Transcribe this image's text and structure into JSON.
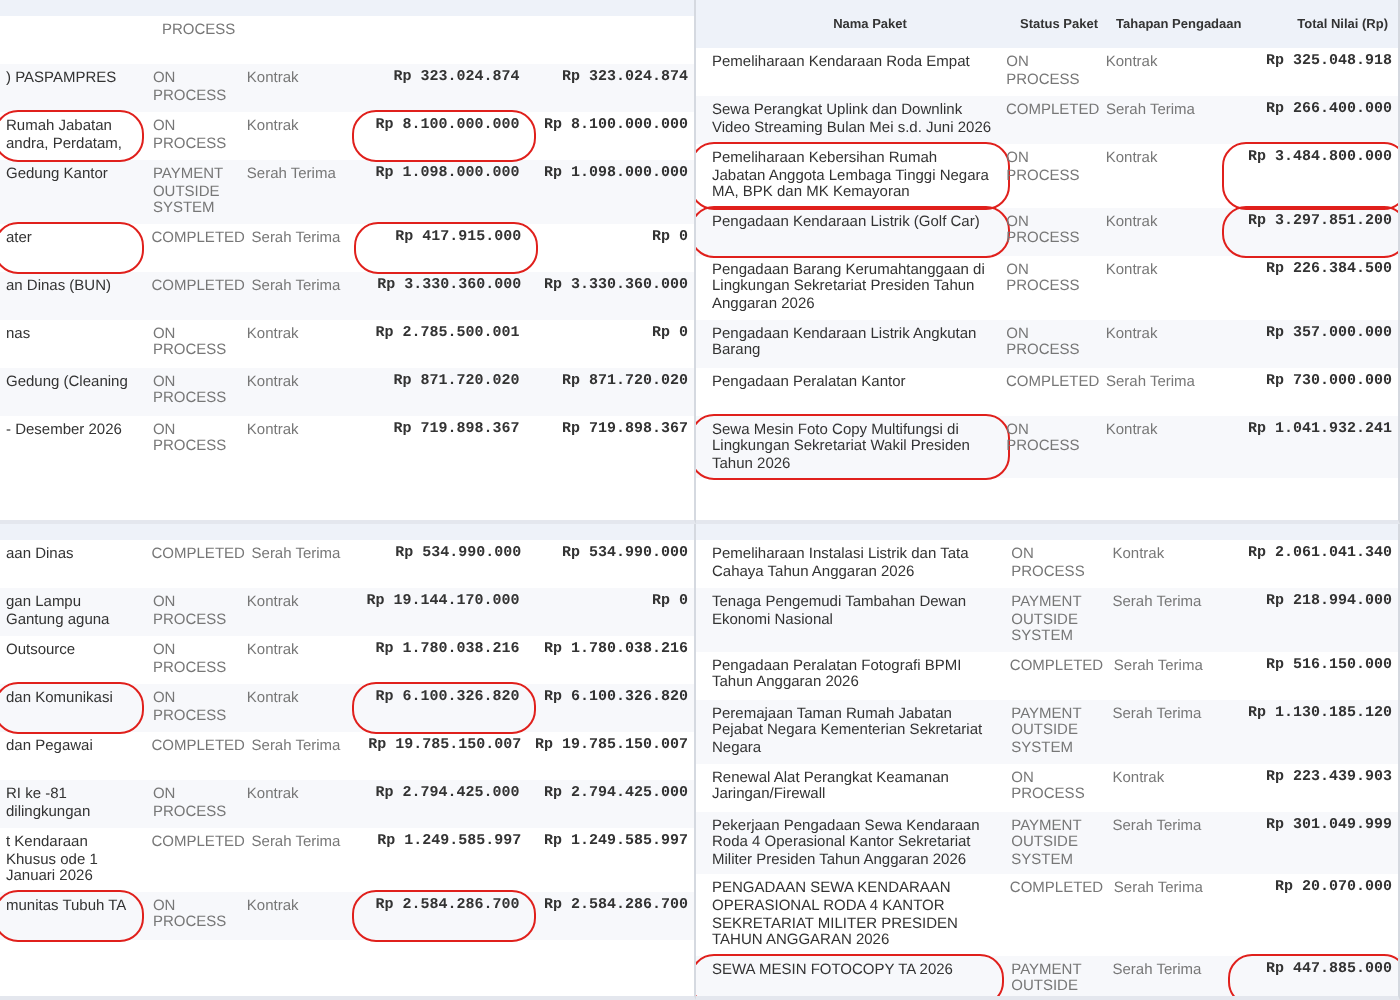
{
  "panels": [
    {
      "rows": [
        {
          "status": "PROCESS"
        },
        {
          "name": ") PASPAMPRES",
          "status": "ON PROCESS",
          "stage": "Kontrak",
          "value": "Rp 323.024.874",
          "value_2": "Rp 323.024.874",
          "circled_name": false,
          "circled_value": false
        },
        {
          "name": "Rumah Jabatan andra, Perdatam,",
          "status": "ON PROCESS",
          "stage": "Kontrak",
          "value": "Rp 8.100.000.000",
          "value_2": "Rp 8.100.000.000",
          "circled_name": true,
          "circled_value": true
        },
        {
          "name": "Gedung Kantor",
          "status": "PAYMENT OUTSIDE SYSTEM",
          "stage": "Serah Terima",
          "value": "Rp 1.098.000.000",
          "value_2": "Rp 1.098.000.000",
          "circled_name": false,
          "circled_value": false
        },
        {
          "name": "ater",
          "status": "COMPLETED",
          "stage": "Serah Terima",
          "value": "Rp 417.915.000",
          "value_2": "Rp 0",
          "circled_name": true,
          "circled_value": true
        },
        {
          "name": "an Dinas (BUN)",
          "status": "COMPLETED",
          "stage": "Serah Terima",
          "value": "Rp 3.330.360.000",
          "value_2": "Rp 3.330.360.000",
          "circled_name": false,
          "circled_value": false
        },
        {
          "name": "nas",
          "status": "ON PROCESS",
          "stage": "Kontrak",
          "value": "Rp 2.785.500.001",
          "value_2": "Rp 0",
          "circled_name": false,
          "circled_value": false
        },
        {
          "name": "Gedung (Cleaning",
          "status": "ON PROCESS",
          "stage": "Kontrak",
          "value": "Rp 871.720.020",
          "value_2": "Rp 871.720.020",
          "circled_name": false,
          "circled_value": false
        },
        {
          "name": "- Desember 2026",
          "status": "ON PROCESS",
          "stage": "Kontrak",
          "value": "Rp 719.898.367",
          "value_2": "Rp 719.898.367",
          "circled_name": false,
          "circled_value": false
        }
      ]
    },
    {
      "rows": [
        {
          "name": "aan Dinas",
          "status": "COMPLETED",
          "stage": "Serah Terima",
          "value": "Rp 534.990.000",
          "value_2": "Rp 534.990.000",
          "circled_name": false,
          "circled_value": false
        },
        {
          "name": "gan Lampu Gantung aguna",
          "status": "ON PROCESS",
          "stage": "Kontrak",
          "value": "Rp 19.144.170.000",
          "value_2": "Rp 0",
          "circled_name": false,
          "circled_value": false
        },
        {
          "name": "Outsource",
          "status": "ON PROCESS",
          "stage": "Kontrak",
          "value": "Rp 1.780.038.216",
          "value_2": "Rp 1.780.038.216",
          "circled_name": false,
          "circled_value": false
        },
        {
          "name": "dan Komunikasi",
          "status": "ON PROCESS",
          "stage": "Kontrak",
          "value": "Rp 6.100.326.820",
          "value_2": "Rp 6.100.326.820",
          "circled_name": true,
          "circled_value": true
        },
        {
          "name": "dan Pegawai",
          "status": "COMPLETED",
          "stage": "Serah Terima",
          "value": "Rp 19.785.150.007",
          "value_2": "Rp 19.785.150.007",
          "circled_name": false,
          "circled_value": false
        },
        {
          "name": "RI ke -81 dilingkungan",
          "status": "ON PROCESS",
          "stage": "Kontrak",
          "value": "Rp 2.794.425.000",
          "value_2": "Rp 2.794.425.000",
          "circled_name": false,
          "circled_value": false
        },
        {
          "name": "t Kendaraan Khusus ode 1 Januari 2026",
          "status": "COMPLETED",
          "stage": "Serah Terima",
          "value": "Rp 1.249.585.997",
          "value_2": "Rp 1.249.585.997",
          "circled_name": false,
          "circled_value": false
        },
        {
          "name": "munitas Tubuh TA",
          "status": "ON PROCESS",
          "stage": "Kontrak",
          "value": "Rp 2.584.286.700",
          "value_2": "Rp 2.584.286.700",
          "circled_name": true,
          "circled_value": true
        }
      ]
    },
    {
      "columns": [
        "Nama Paket",
        "Status Paket",
        "Tahapan Pengadaan",
        "Total Nilai (Rp)"
      ],
      "rows": [
        {
          "name": "Pemeliharaan Kendaraan Roda Empat",
          "status": "ON PROCESS",
          "stage": "Kontrak",
          "value": "Rp 325.048.918",
          "circled_name": false,
          "circled_value": false
        },
        {
          "name": "Sewa Perangkat Uplink dan Downlink Video Streaming Bulan Mei s.d. Juni 2026",
          "status": "COMPLETED",
          "stage": "Serah Terima",
          "value": "Rp 266.400.000",
          "circled_name": false,
          "circled_value": false
        },
        {
          "name": "Pemeliharaan Kebersihan Rumah Jabatan Anggota Lembaga Tinggi Negara MA, BPK dan MK Kemayoran",
          "status": "ON PROCESS",
          "stage": "Kontrak",
          "value": "Rp 3.484.800.000",
          "circled_name": true,
          "circled_value": true
        },
        {
          "name": "Pengadaan Kendaraan Listrik (Golf Car)",
          "status": "ON PROCESS",
          "stage": "Kontrak",
          "value": "Rp 3.297.851.200",
          "circled_name": true,
          "circled_value": true
        },
        {
          "name": "Pengadaan Barang Kerumahtanggaan di Lingkungan Sekretariat Presiden Tahun Anggaran 2026",
          "status": "ON PROCESS",
          "stage": "Kontrak",
          "value": "Rp 226.384.500",
          "circled_name": false,
          "circled_value": false
        },
        {
          "name": "Pengadaan Kendaraan Listrik Angkutan Barang",
          "status": "ON PROCESS",
          "stage": "Kontrak",
          "value": "Rp 357.000.000",
          "circled_name": false,
          "circled_value": false
        },
        {
          "name": "Pengadaan Peralatan Kantor",
          "status": "COMPLETED",
          "stage": "Serah Terima",
          "value": "Rp 730.000.000",
          "circled_name": false,
          "circled_value": false
        },
        {
          "name": "Sewa Mesin Foto Copy Multifungsi di Lingkungan Sekretariat Wakil Presiden Tahun 2026",
          "status": "ON PROCESS",
          "stage": "Kontrak",
          "value": "Rp 1.041.932.241",
          "circled_name": true,
          "circled_value": false
        }
      ]
    },
    {
      "rows": [
        {
          "name": "Pemeliharaan Instalasi Listrik dan Tata Cahaya Tahun Anggaran 2026",
          "status": "ON PROCESS",
          "stage": "Kontrak",
          "value": "Rp 2.061.041.340",
          "circled_name": false,
          "circled_value": false
        },
        {
          "name": "Tenaga Pengemudi Tambahan Dewan Ekonomi Nasional",
          "status": "PAYMENT OUTSIDE SYSTEM",
          "stage": "Serah Terima",
          "value": "Rp 218.994.000",
          "circled_name": false,
          "circled_value": false
        },
        {
          "name": "Pengadaan Peralatan Fotografi BPMI Tahun Anggaran 2026",
          "status": "COMPLETED",
          "stage": "Serah Terima",
          "value": "Rp 516.150.000",
          "circled_name": false,
          "circled_value": false
        },
        {
          "name": "Peremajaan Taman Rumah Jabatan Pejabat Negara Kementerian Sekretariat Negara",
          "status": "PAYMENT OUTSIDE SYSTEM",
          "stage": "Serah Terima",
          "value": "Rp 1.130.185.120",
          "circled_name": false,
          "circled_value": false
        },
        {
          "name": "Renewal Alat Perangkat Keamanan Jaringan/Firewall",
          "status": "ON PROCESS",
          "stage": "Kontrak",
          "value": "Rp 223.439.903",
          "circled_name": false,
          "circled_value": false
        },
        {
          "name": "Pekerjaan Pengadaan Sewa Kendaraan Roda 4 Operasional Kantor Sekretariat Militer Presiden Tahun Anggaran 2026",
          "status": "PAYMENT OUTSIDE SYSTEM",
          "stage": "Serah Terima",
          "value": "Rp 301.049.999",
          "circled_name": false,
          "circled_value": false
        },
        {
          "name": "PENGADAAN SEWA KENDARAAN OPERASIONAL RODA 4 KANTOR SEKRETARIAT MILITER PRESIDEN TAHUN ANGGARAN 2026",
          "status": "COMPLETED",
          "stage": "Serah Terima",
          "value": "Rp 20.070.000",
          "circled_name": false,
          "circled_value": false
        },
        {
          "name": "SEWA MESIN FOTOCOPY TA 2026",
          "status": "PAYMENT OUTSIDE",
          "stage": "Serah Terima",
          "value": "Rp 447.885.000",
          "circled_name": true,
          "circled_value": true
        }
      ]
    }
  ]
}
